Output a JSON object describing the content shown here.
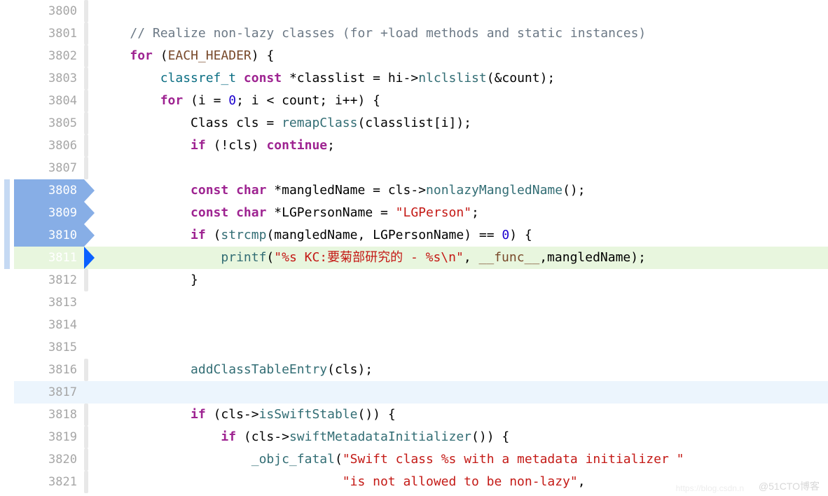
{
  "lines": [
    {
      "num": "3800",
      "bp": "",
      "change": false,
      "fold": true,
      "kind": "",
      "tokens": []
    },
    {
      "num": "3801",
      "bp": "",
      "change": false,
      "fold": true,
      "kind": "",
      "tokens": [
        {
          "c": "tok-text",
          "t": "    "
        },
        {
          "c": "tok-comment",
          "t": "// Realize non-lazy classes (for +load methods and static instances)"
        }
      ]
    },
    {
      "num": "3802",
      "bp": "",
      "change": false,
      "fold": true,
      "kind": "",
      "tokens": [
        {
          "c": "tok-text",
          "t": "    "
        },
        {
          "c": "tok-keyword",
          "t": "for"
        },
        {
          "c": "tok-text",
          "t": " ("
        },
        {
          "c": "tok-macro",
          "t": "EACH_HEADER"
        },
        {
          "c": "tok-text",
          "t": ") {"
        }
      ]
    },
    {
      "num": "3803",
      "bp": "",
      "change": false,
      "fold": true,
      "kind": "",
      "tokens": [
        {
          "c": "tok-text",
          "t": "        "
        },
        {
          "c": "tok-type",
          "t": "classref_t"
        },
        {
          "c": "tok-text",
          "t": " "
        },
        {
          "c": "tok-keyword",
          "t": "const"
        },
        {
          "c": "tok-text",
          "t": " *classlist = hi->"
        },
        {
          "c": "tok-member",
          "t": "nlclslist"
        },
        {
          "c": "tok-text",
          "t": "(&count);"
        }
      ]
    },
    {
      "num": "3804",
      "bp": "",
      "change": false,
      "fold": true,
      "kind": "",
      "tokens": [
        {
          "c": "tok-text",
          "t": "        "
        },
        {
          "c": "tok-keyword",
          "t": "for"
        },
        {
          "c": "tok-text",
          "t": " (i = "
        },
        {
          "c": "tok-number",
          "t": "0"
        },
        {
          "c": "tok-text",
          "t": "; i < count; i++) {"
        }
      ]
    },
    {
      "num": "3805",
      "bp": "",
      "change": false,
      "fold": true,
      "kind": "",
      "tokens": [
        {
          "c": "tok-text",
          "t": "            Class cls = "
        },
        {
          "c": "tok-func",
          "t": "remapClass"
        },
        {
          "c": "tok-text",
          "t": "(classlist[i]);"
        }
      ]
    },
    {
      "num": "3806",
      "bp": "",
      "change": false,
      "fold": true,
      "kind": "",
      "tokens": [
        {
          "c": "tok-text",
          "t": "            "
        },
        {
          "c": "tok-keyword",
          "t": "if"
        },
        {
          "c": "tok-text",
          "t": " (!cls) "
        },
        {
          "c": "tok-keyword",
          "t": "continue"
        },
        {
          "c": "tok-text",
          "t": ";"
        }
      ]
    },
    {
      "num": "3807",
      "bp": "",
      "change": false,
      "fold": true,
      "kind": "",
      "tokens": []
    },
    {
      "num": "3808",
      "bp": "dim",
      "change": true,
      "fold": false,
      "kind": "",
      "tokens": [
        {
          "c": "tok-text",
          "t": "            "
        },
        {
          "c": "tok-keyword",
          "t": "const"
        },
        {
          "c": "tok-text",
          "t": " "
        },
        {
          "c": "tok-keyword",
          "t": "char"
        },
        {
          "c": "tok-text",
          "t": " *mangledName = cls->"
        },
        {
          "c": "tok-member",
          "t": "nonlazyMangledName"
        },
        {
          "c": "tok-text",
          "t": "();"
        }
      ]
    },
    {
      "num": "3809",
      "bp": "dim",
      "change": true,
      "fold": false,
      "kind": "",
      "tokens": [
        {
          "c": "tok-text",
          "t": "            "
        },
        {
          "c": "tok-keyword",
          "t": "const"
        },
        {
          "c": "tok-text",
          "t": " "
        },
        {
          "c": "tok-keyword",
          "t": "char"
        },
        {
          "c": "tok-text",
          "t": " *LGPersonName = "
        },
        {
          "c": "tok-string",
          "t": "\"LGPerson\""
        },
        {
          "c": "tok-text",
          "t": ";"
        }
      ]
    },
    {
      "num": "3810",
      "bp": "dim",
      "change": true,
      "fold": false,
      "kind": "",
      "tokens": [
        {
          "c": "tok-text",
          "t": "            "
        },
        {
          "c": "tok-keyword",
          "t": "if"
        },
        {
          "c": "tok-text",
          "t": " ("
        },
        {
          "c": "tok-func",
          "t": "strcmp"
        },
        {
          "c": "tok-text",
          "t": "(mangledName, LGPersonName) == "
        },
        {
          "c": "tok-number",
          "t": "0"
        },
        {
          "c": "tok-text",
          "t": ") {"
        }
      ]
    },
    {
      "num": "3811",
      "bp": "active",
      "change": true,
      "fold": false,
      "kind": "exec",
      "tokens": [
        {
          "c": "tok-text",
          "t": "                "
        },
        {
          "c": "tok-func",
          "t": "printf"
        },
        {
          "c": "tok-text",
          "t": "("
        },
        {
          "c": "tok-string",
          "t": "\"%s KC:要菊部研究的 - %s\\n\""
        },
        {
          "c": "tok-text",
          "t": ", "
        },
        {
          "c": "tok-macro",
          "t": "__func__"
        },
        {
          "c": "tok-text",
          "t": ",mangledName);"
        }
      ]
    },
    {
      "num": "3812",
      "bp": "",
      "change": false,
      "fold": true,
      "kind": "",
      "tokens": [
        {
          "c": "tok-text",
          "t": "            }"
        }
      ]
    },
    {
      "num": "3813",
      "bp": "",
      "change": false,
      "fold": false,
      "kind": "",
      "tokens": []
    },
    {
      "num": "3814",
      "bp": "",
      "change": false,
      "fold": false,
      "kind": "",
      "tokens": []
    },
    {
      "num": "3815",
      "bp": "",
      "change": false,
      "fold": false,
      "kind": "",
      "tokens": []
    },
    {
      "num": "3816",
      "bp": "",
      "change": false,
      "fold": true,
      "kind": "",
      "tokens": [
        {
          "c": "tok-text",
          "t": "            "
        },
        {
          "c": "tok-func",
          "t": "addClassTableEntry"
        },
        {
          "c": "tok-text",
          "t": "(cls);"
        }
      ]
    },
    {
      "num": "3817",
      "bp": "",
      "change": false,
      "fold": false,
      "kind": "cursor",
      "tokens": []
    },
    {
      "num": "3818",
      "bp": "",
      "change": false,
      "fold": true,
      "kind": "",
      "tokens": [
        {
          "c": "tok-text",
          "t": "            "
        },
        {
          "c": "tok-keyword",
          "t": "if"
        },
        {
          "c": "tok-text",
          "t": " (cls->"
        },
        {
          "c": "tok-member",
          "t": "isSwiftStable"
        },
        {
          "c": "tok-text",
          "t": "()) {"
        }
      ]
    },
    {
      "num": "3819",
      "bp": "",
      "change": false,
      "fold": true,
      "kind": "",
      "tokens": [
        {
          "c": "tok-text",
          "t": "                "
        },
        {
          "c": "tok-keyword",
          "t": "if"
        },
        {
          "c": "tok-text",
          "t": " (cls->"
        },
        {
          "c": "tok-member",
          "t": "swiftMetadataInitializer"
        },
        {
          "c": "tok-text",
          "t": "()) {"
        }
      ]
    },
    {
      "num": "3820",
      "bp": "",
      "change": false,
      "fold": true,
      "kind": "",
      "tokens": [
        {
          "c": "tok-text",
          "t": "                    "
        },
        {
          "c": "tok-func",
          "t": "_objc_fatal"
        },
        {
          "c": "tok-text",
          "t": "("
        },
        {
          "c": "tok-string",
          "t": "\"Swift class %s with a metadata initializer \""
        }
      ]
    },
    {
      "num": "3821",
      "bp": "",
      "change": false,
      "fold": true,
      "kind": "",
      "tokens": [
        {
          "c": "tok-text",
          "t": "                                "
        },
        {
          "c": "tok-string",
          "t": "\"is not allowed to be non-lazy\""
        },
        {
          "c": "tok-text",
          "t": ","
        }
      ]
    }
  ],
  "watermark": "@51CTO博客",
  "watermark2": "https://blog.csdn.n"
}
